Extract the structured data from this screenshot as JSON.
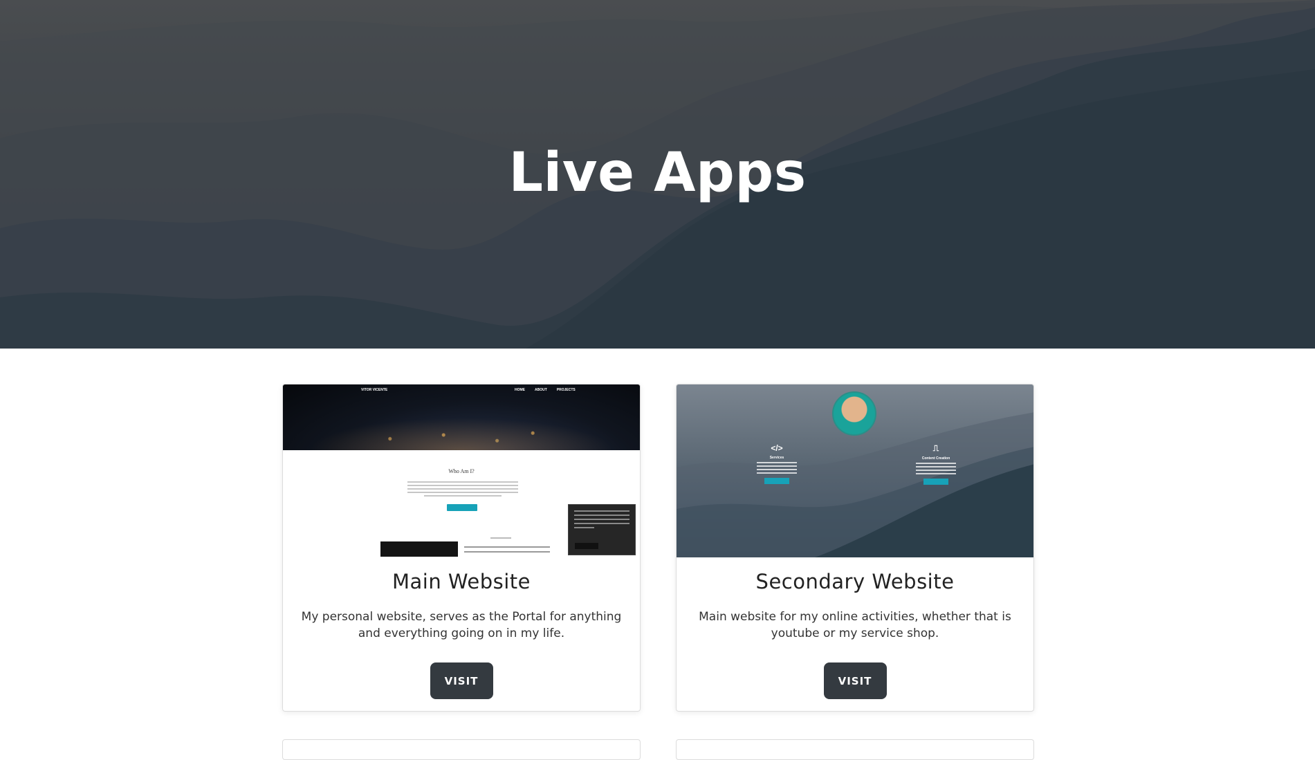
{
  "hero": {
    "title": "Live Apps"
  },
  "cards": [
    {
      "title": "Main Website",
      "description": "My personal website, serves as the Portal for anything and everything going on in my life.",
      "button_label": "VISIT",
      "thumbnail": {
        "nav_brand": "VITOR VICENTE",
        "nav_links": [
          "HOME",
          "ABOUT",
          "PROJECTS"
        ],
        "heading": "Who Am I?"
      }
    },
    {
      "title": "Secondary Website",
      "description": "Main website for my online activities, whether that is youtube or my service shop.",
      "button_label": "VISIT",
      "thumbnail": {
        "col1_title": "Services",
        "col2_title": "Content Creation"
      }
    }
  ],
  "colors": {
    "button_bg": "#343a40",
    "accent": "#17a2b8"
  }
}
